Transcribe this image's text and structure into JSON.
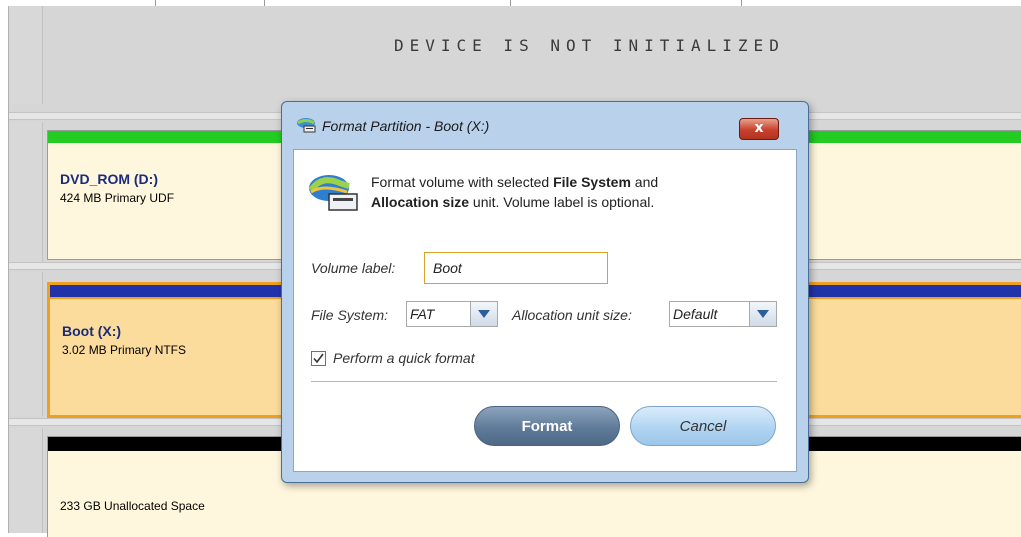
{
  "status_banner": "DEVICE IS NOT INITIALIZED",
  "partitions": [
    {
      "name": "DVD_ROM (D:)",
      "desc": "424 MB Primary UDF",
      "bar_color": "#22cc22"
    },
    {
      "name": "Boot (X:)",
      "desc": "3.02 MB Primary NTFS",
      "bar_color": "#2233aa",
      "selected": true
    },
    {
      "name": "",
      "desc": "233 GB Unallocated Space",
      "bar_color": "#000000"
    }
  ],
  "dialog": {
    "title": "Format Partition - Boot (X:)",
    "close_label": "x",
    "description_pre": "Format volume with selected ",
    "description_bold1": "File System",
    "description_mid": " and",
    "description_bold2": "Allocation size",
    "description_post": " unit. Volume label is optional.",
    "volume_label_caption": "Volume label:",
    "volume_label_value": "Boot",
    "file_system_caption": "File System:",
    "file_system_value": "FAT",
    "alloc_caption": "Allocation unit size:",
    "alloc_value": "Default",
    "quick_format_label": "Perform a quick format",
    "quick_format_checked": true,
    "format_button": "Format",
    "cancel_button": "Cancel"
  },
  "colors": {
    "selected_border": "#f0a020",
    "partition_bg": "#fff7dd",
    "selected_bg": "#fbdc9c"
  }
}
